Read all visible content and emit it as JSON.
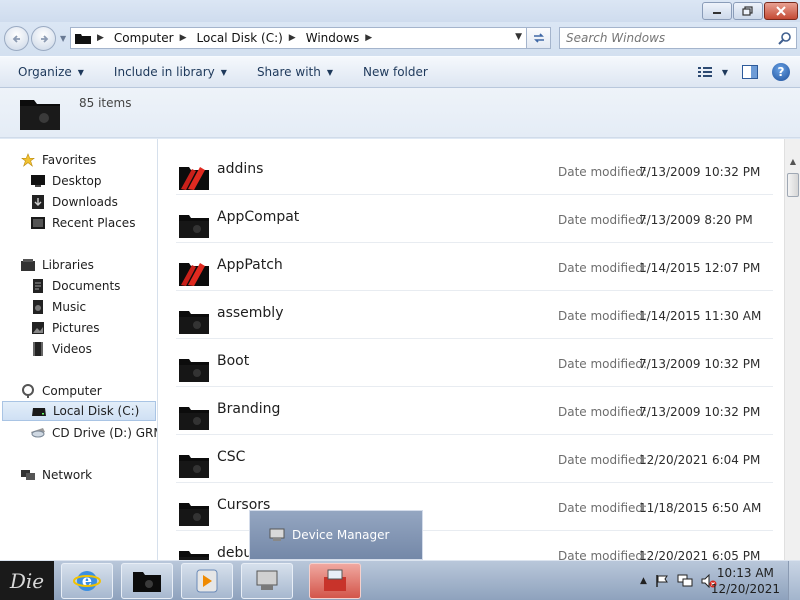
{
  "window": {
    "caption_buttons": [
      "minimize",
      "restore",
      "close"
    ]
  },
  "address": {
    "crumbs": [
      "Computer",
      "Local Disk (C:)",
      "Windows"
    ],
    "search_placeholder": "Search Windows"
  },
  "commands": {
    "organize": "Organize",
    "include_in_library": "Include in library",
    "share_with": "Share with",
    "new_folder": "New folder"
  },
  "info": {
    "count": "85 items"
  },
  "nav": {
    "favorites": "Favorites",
    "desktop": "Desktop",
    "downloads": "Downloads",
    "recent_places": "Recent Places",
    "libraries": "Libraries",
    "documents": "Documents",
    "music": "Music",
    "pictures": "Pictures",
    "videos": "Videos",
    "computer": "Computer",
    "local_disk": "Local Disk (C:)",
    "cd_drive": "CD Drive (D:) GRMC",
    "network": "Network"
  },
  "files": {
    "date_label": "Date modified:",
    "rows": [
      {
        "name": "addins",
        "date": "7/13/2009 10:32 PM",
        "icon": "red-folder"
      },
      {
        "name": "AppCompat",
        "date": "7/13/2009 8:20 PM",
        "icon": "black-folder"
      },
      {
        "name": "AppPatch",
        "date": "1/14/2015 12:07 PM",
        "icon": "red-folder"
      },
      {
        "name": "assembly",
        "date": "1/14/2015 11:30 AM",
        "icon": "black-folder"
      },
      {
        "name": "Boot",
        "date": "7/13/2009 10:32 PM",
        "icon": "black-folder"
      },
      {
        "name": "Branding",
        "date": "7/13/2009 10:32 PM",
        "icon": "black-folder"
      },
      {
        "name": "CSC",
        "date": "12/20/2021 6:04 PM",
        "icon": "black-folder"
      },
      {
        "name": "Cursors",
        "date": "11/18/2015 6:50 AM",
        "icon": "black-folder"
      },
      {
        "name": "debu",
        "date": "12/20/2021 6:05 PM",
        "icon": "black-folder"
      }
    ]
  },
  "popup": {
    "label": "Device Manager"
  },
  "taskbar": {
    "start_label": "Die",
    "time": "10:13 AM",
    "date": "12/20/2021"
  },
  "colors": {
    "close_button": "#c44a34",
    "active_task": "#d3554a",
    "popup_bg": "#7488a8"
  }
}
